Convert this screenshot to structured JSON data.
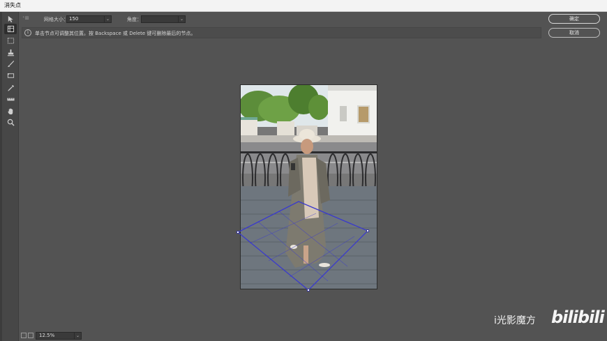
{
  "window": {
    "title": "消失点"
  },
  "tools": [
    {
      "name": "edit-plane-tool-icon",
      "active": false
    },
    {
      "name": "create-plane-tool-icon",
      "active": true
    },
    {
      "name": "marquee-tool-icon",
      "active": false
    },
    {
      "name": "stamp-tool-icon",
      "active": false
    },
    {
      "name": "brush-tool-icon",
      "active": false
    },
    {
      "name": "transform-tool-icon",
      "active": false
    },
    {
      "name": "eyedropper-tool-icon",
      "active": false
    },
    {
      "name": "measure-tool-icon",
      "active": false
    },
    {
      "name": "hand-tool-icon",
      "active": false
    },
    {
      "name": "zoom-tool-icon",
      "active": false
    }
  ],
  "options": {
    "grid_label": "网格大小：",
    "grid_value": "150",
    "angle_label": "角度：",
    "angle_value": ""
  },
  "info": {
    "icon": "info-icon",
    "text": "单击节点可调整其位置。按 Backspace 或 Delete 键可删除最后的节点。"
  },
  "buttons": {
    "ok_label": "确定",
    "cancel_label": "取消"
  },
  "status": {
    "zoom_value": "12.5%"
  },
  "watermark": {
    "text": "i光影魔方",
    "logo": "bilibili"
  },
  "colors": {
    "grid_line": "#3a3acc",
    "background": "#535353"
  }
}
